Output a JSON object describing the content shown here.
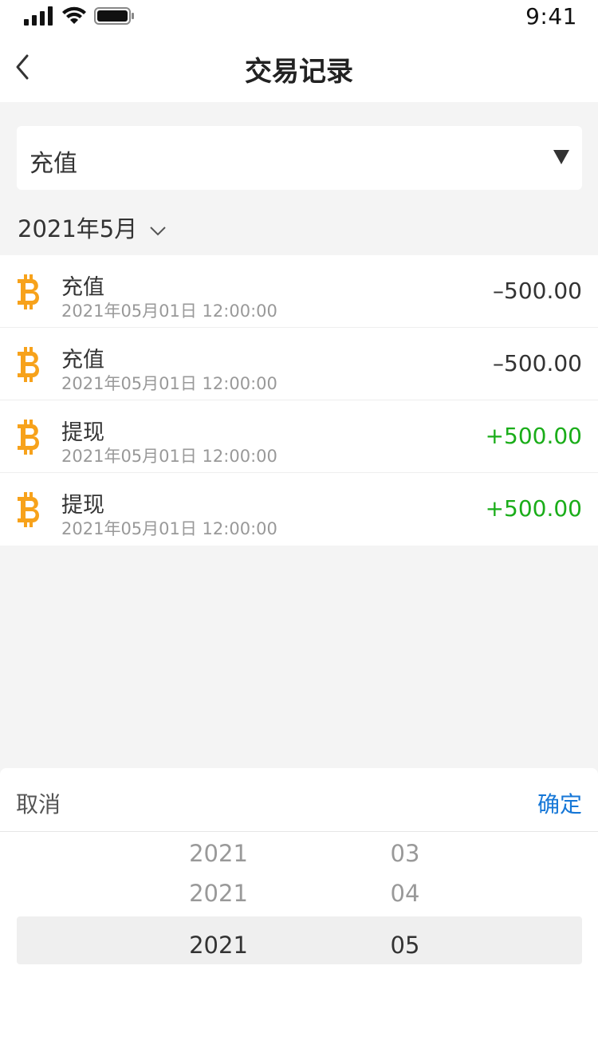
{
  "status_bar": {
    "time": "9:41",
    "icons": [
      "signal-icon",
      "wifi-icon",
      "battery-icon"
    ]
  },
  "nav": {
    "title": "交易记录",
    "back_icon": "chevron-left-icon"
  },
  "filter": {
    "selected": "充值",
    "arrow_icon": "triangle-down-icon"
  },
  "month_filter": {
    "label": "2021年5月",
    "chevron_icon": "chevron-down-icon"
  },
  "transactions": [
    {
      "title": "充值",
      "time": "2021年05月01日 12:00:00",
      "amount": "–500.00",
      "type": "minus",
      "icon": "bitcoin-icon"
    },
    {
      "title": "充值",
      "time": "2021年05月01日 12:00:00",
      "amount": "–500.00",
      "type": "minus",
      "icon": "bitcoin-icon"
    },
    {
      "title": "提现",
      "time": "2021年05月01日 12:00:00",
      "amount": "+500.00",
      "type": "plus",
      "icon": "bitcoin-icon"
    },
    {
      "title": "提现",
      "time": "2021年05月01日 12:00:00",
      "amount": "+500.00",
      "type": "plus",
      "icon": "bitcoin-icon"
    }
  ],
  "picker": {
    "cancel": "取消",
    "confirm": "确定",
    "years": [
      "2021",
      "2021",
      "2021"
    ],
    "months": [
      "03",
      "04",
      "05"
    ],
    "selected_year": "2021",
    "selected_month": "05"
  },
  "colors": {
    "accent": "#1677d7",
    "positive": "#1aad19",
    "coin": "#f7a21b",
    "background": "#f4f4f4"
  }
}
